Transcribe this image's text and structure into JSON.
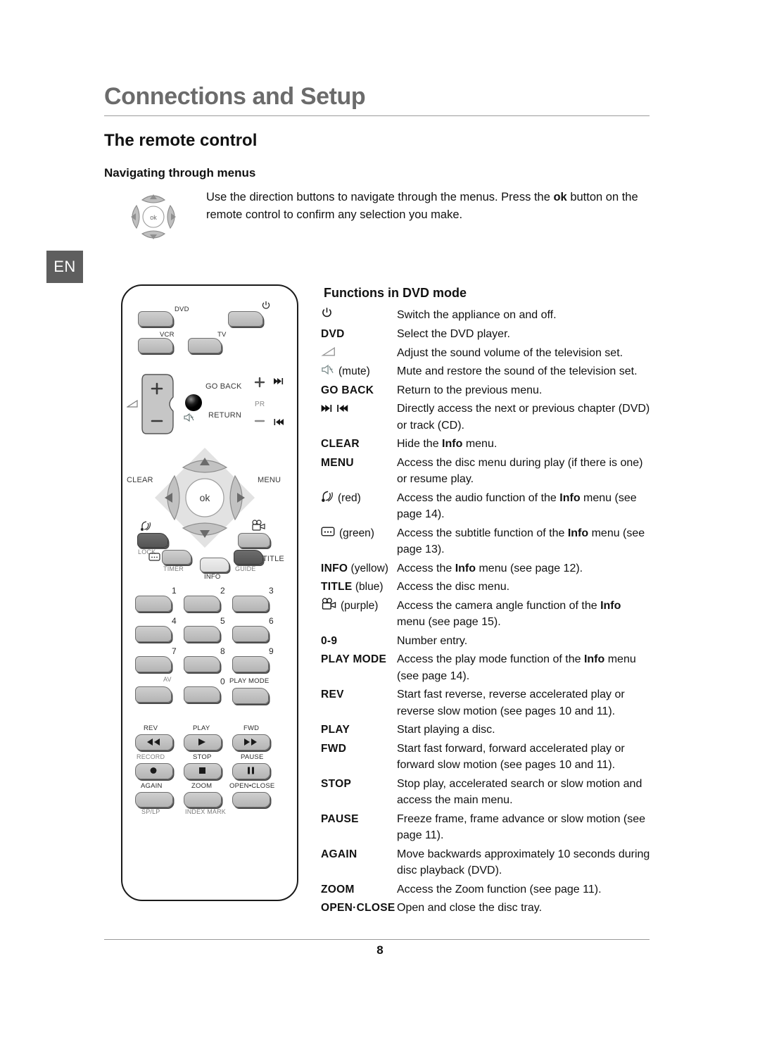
{
  "header": {
    "title": "Connections and Setup",
    "section": "The remote control",
    "subsection": "Navigating through menus"
  },
  "lang_tab": "EN",
  "intro": {
    "text_part1": "Use the direction buttons to navigate through the menus. Press the ",
    "bold": "ok",
    "text_part2": " button on the remote control to confirm any selection you make."
  },
  "functions": {
    "heading": "Functions in DVD mode",
    "rows": [
      {
        "key": "",
        "icon": "power-icon",
        "desc": "Switch the appliance on and off."
      },
      {
        "key": "DVD",
        "bold": true,
        "desc": "Select the DVD player."
      },
      {
        "key": "",
        "icon": "volume-icon",
        "desc": "Adjust the sound volume of the television set."
      },
      {
        "key": "(mute)",
        "icon": "mute-icon",
        "desc": "Mute and restore the sound of the television set."
      },
      {
        "key": "GO BACK",
        "bold": true,
        "desc": "Return to the previous menu."
      },
      {
        "key": "",
        "icon": "skip-icons",
        "desc": "Directly access the next or previous chapter (DVD) or track (CD)."
      },
      {
        "key": "CLEAR",
        "bold": true,
        "desc": "Hide the |Info| menu."
      },
      {
        "key": "MENU",
        "bold": true,
        "desc": "Access the disc menu during play (if there is one) or resume play."
      },
      {
        "key": "(red)",
        "icon": "audio-icon",
        "desc": "Access the audio function of the |Info| menu (see page 14)."
      },
      {
        "key": "(green)",
        "icon": "subtitle-icon",
        "desc": "Access the subtitle function of the |Info| menu (see page 13)."
      },
      {
        "key": "INFO (yellow)",
        "bold": true,
        "paren": "(yellow)",
        "keymain": "INFO",
        "desc": "Access the |Info| menu (see page 12)."
      },
      {
        "key": "TITLE (blue)",
        "bold": true,
        "paren": "(blue)",
        "keymain": "TITLE",
        "desc": "Access the disc menu."
      },
      {
        "key": "(purple)",
        "icon": "camera-icon",
        "desc": "Access the camera angle function of the |Info| menu (see page 15)."
      },
      {
        "key": "0-9",
        "bold": true,
        "desc": "Number entry."
      },
      {
        "key": "PLAY MODE",
        "bold": true,
        "desc": "Access the play mode function of the |Info| menu (see page 14)."
      },
      {
        "key": "REV",
        "bold": true,
        "desc": "Start fast reverse, reverse accelerated play or reverse slow motion (see pages 10 and 11)."
      },
      {
        "key": "PLAY",
        "bold": true,
        "desc": "Start playing a disc."
      },
      {
        "key": "FWD",
        "bold": true,
        "desc": "Start fast forward, forward accelerated play or forward slow motion (see pages 10 and 11)."
      },
      {
        "key": "STOP",
        "bold": true,
        "desc": "Stop play, accelerated search or slow motion and access the main menu."
      },
      {
        "key": "PAUSE",
        "bold": true,
        "desc": "Freeze frame, frame advance or slow motion (see page 11)."
      },
      {
        "key": "AGAIN",
        "bold": true,
        "desc": "Move backwards approximately 10 seconds during disc playback (DVD)."
      },
      {
        "key": "ZOOM",
        "bold": true,
        "desc": "Access the Zoom function (see page 11)."
      },
      {
        "key": "OPEN·CLOSE",
        "bold": true,
        "desc": "Open and close the disc tray."
      }
    ]
  },
  "remote_labels": {
    "dvd": "DVD",
    "vcr": "VCR",
    "tv": "TV",
    "go_back": "GO BACK",
    "return": "RETURN",
    "pr": "PR",
    "clear": "CLEAR",
    "menu": "MENU",
    "ok": "ok",
    "lock": "LOCK",
    "timer": "TIMER",
    "info": "INFO",
    "guide": "GUIDE",
    "title": "TITLE",
    "av": "AV",
    "play_mode": "PLAY MODE",
    "rev": "REV",
    "play": "PLAY",
    "fwd": "FWD",
    "record": "RECORD",
    "stop": "STOP",
    "pause": "PAUSE",
    "again": "AGAIN",
    "zoom": "ZOOM",
    "open_close": "OPEN•CLOSE",
    "sp_lp": "SP/LP",
    "index_mark": "INDEX MARK",
    "numbers": [
      "1",
      "2",
      "3",
      "4",
      "5",
      "6",
      "7",
      "8",
      "9",
      "0"
    ]
  },
  "footer": {
    "page_number": "8"
  },
  "colors": {
    "heading_gray": "#6b6b6b",
    "rule_gray": "#9a9a9a",
    "lang_tab_bg": "#5e5e5e",
    "key_gray": "#c4c4c4",
    "key_dark": "#5f5f5f"
  }
}
